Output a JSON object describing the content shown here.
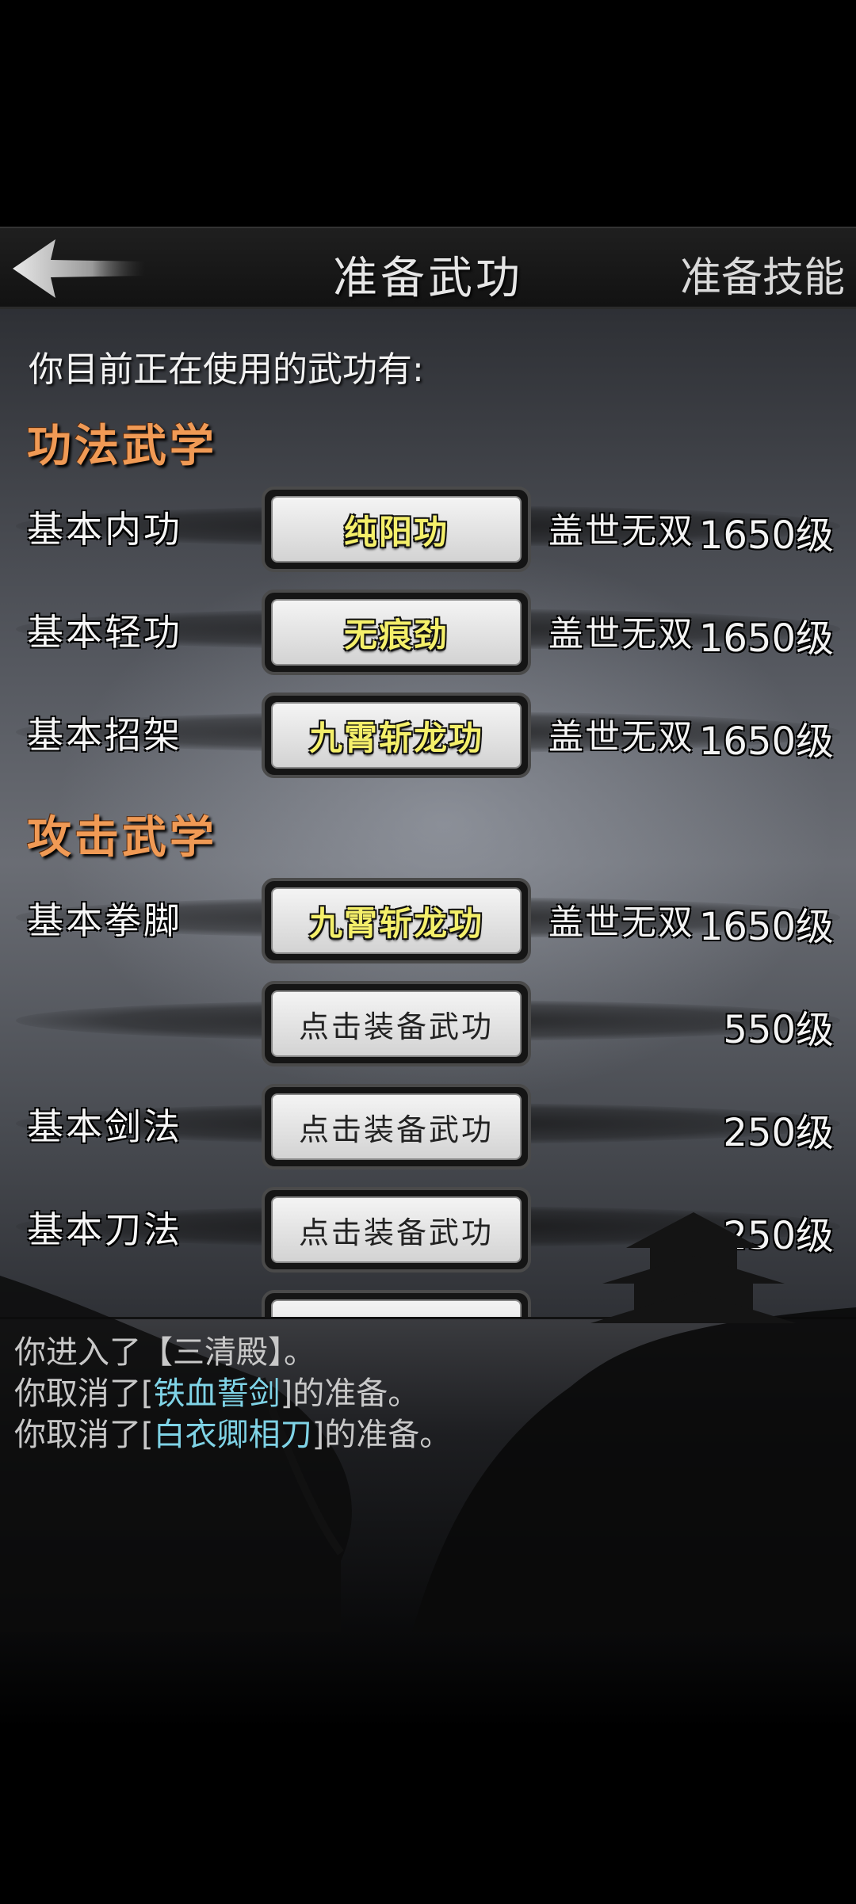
{
  "header": {
    "title": "准备武功",
    "right_tab": "准备技能"
  },
  "intro_text": "你目前正在使用的武功有:",
  "sections": [
    {
      "heading": "功法武学",
      "rows": [
        {
          "label": "基本内功",
          "equipped": "纯阳功",
          "rank": "盖世无双",
          "level": "1650级"
        },
        {
          "label": "基本轻功",
          "equipped": "无痕劲",
          "rank": "盖世无双",
          "level": "1650级"
        },
        {
          "label": "基本招架",
          "equipped": "九霄斩龙功",
          "rank": "盖世无双",
          "level": "1650级"
        }
      ]
    },
    {
      "heading": "攻击武学",
      "rows": [
        {
          "label": "基本拳脚",
          "equipped": "九霄斩龙功",
          "rank": "盖世无双",
          "level": "1650级"
        },
        {
          "label": "",
          "empty_slot": "点击装备武功",
          "level": "550级"
        },
        {
          "label": "基本剑法",
          "empty_slot": "点击装备武功",
          "level": "250级"
        },
        {
          "label": "基本刀法",
          "empty_slot": "点击装备武功",
          "level": "250级"
        }
      ]
    }
  ],
  "log": [
    {
      "prefix": "你进入了【三清殿】。",
      "highlight": "",
      "suffix": ""
    },
    {
      "prefix": "你取消了[",
      "highlight": "铁血誓剑",
      "suffix": "]的准备。"
    },
    {
      "prefix": "你取消了[",
      "highlight": "白衣卿相刀",
      "suffix": "]的准备。"
    }
  ],
  "colors": {
    "section_heading": "#f09a55",
    "equipped_skill": "#f4ef6a",
    "log_highlight": "#7fd3e6"
  },
  "icons": {
    "back": "back-arrow-icon"
  }
}
